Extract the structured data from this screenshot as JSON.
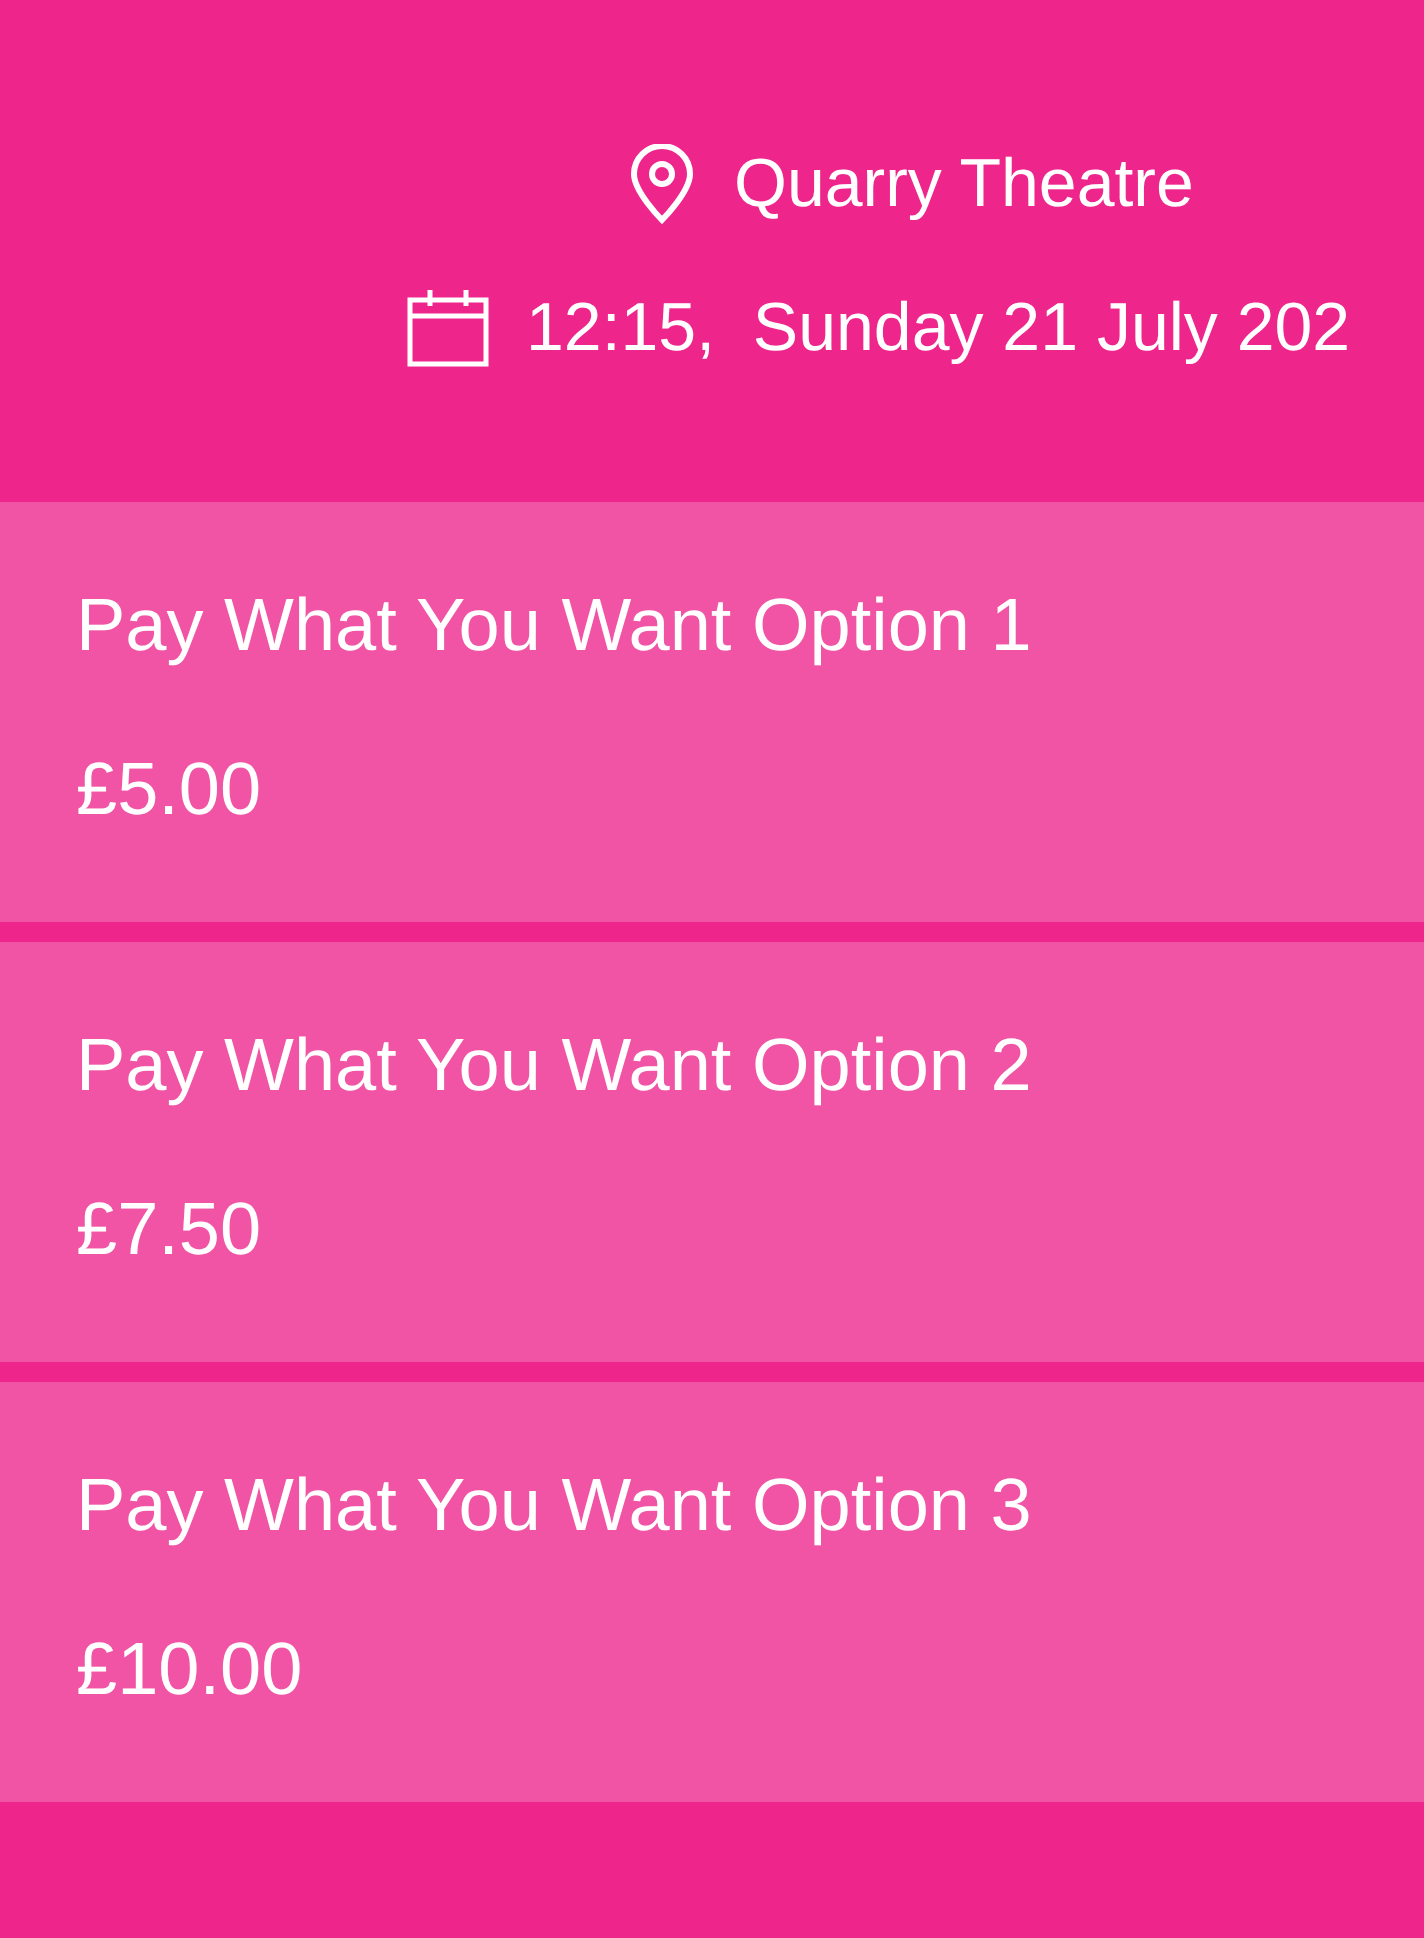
{
  "venue": {
    "location": "Quarry Theatre",
    "datetime": "12:15,  Sunday 21 July 202"
  },
  "options": [
    {
      "name": "Pay What You Want Option 1",
      "price": "£5.00"
    },
    {
      "name": "Pay What You Want Option 2",
      "price": "£7.50"
    },
    {
      "name": "Pay What You Want Option 3",
      "price": "£10.00"
    }
  ]
}
